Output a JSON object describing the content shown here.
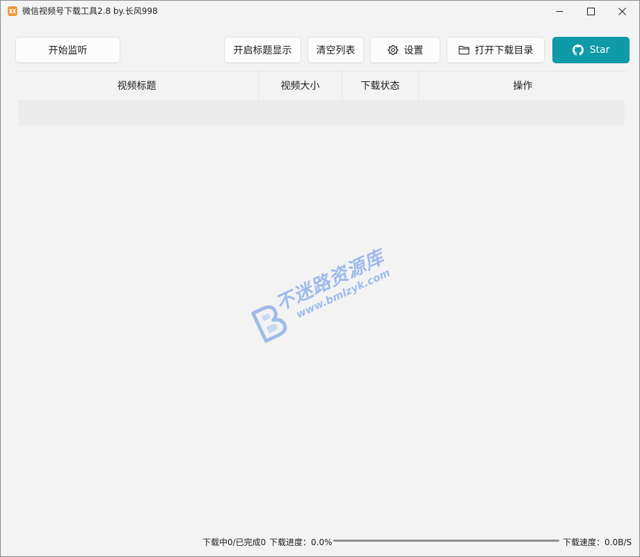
{
  "window": {
    "title": "微信视频号下载工具2.8 by.长风998",
    "app_icon": "app-logo-icon",
    "controls": {
      "minimize_icon": "minimize-icon",
      "maximize_icon": "maximize-icon",
      "close_icon": "close-icon"
    }
  },
  "toolbar": {
    "start_listen_label": "开始监听",
    "title_display_label": "开启标题显示",
    "clear_list_label": "清空列表",
    "settings_label": "设置",
    "settings_icon": "gear-icon",
    "open_dir_label": "打开下载目录",
    "open_dir_icon": "folder-icon",
    "star_label": "Star",
    "star_icon": "github-icon",
    "accent_color": "#0e9aa7"
  },
  "table": {
    "columns": [
      "视频标题",
      "视频大小",
      "下载状态",
      "操作"
    ],
    "rows": []
  },
  "watermark": {
    "text_cn": "不迷路资源库",
    "url": "www.bmlzyk.com"
  },
  "status": {
    "downloading_text": "下载中0/已完成0",
    "progress_text": "下载进度：0.0%",
    "progress_fraction": 0.0,
    "speed_text": "下载速度：0.0B/S"
  }
}
